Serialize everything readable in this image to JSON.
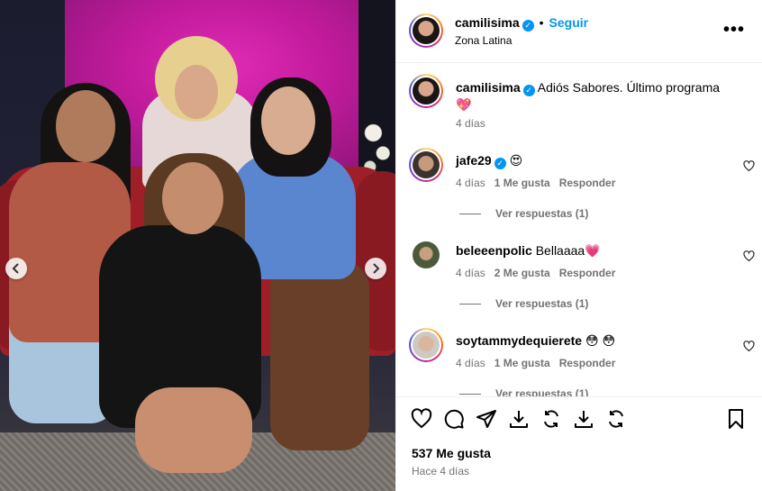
{
  "post": {
    "username": "camilisima",
    "verified_mark": "✓",
    "dot": "•",
    "follow_label": "Seguir",
    "location": "Zona Latina",
    "more_label": "•••"
  },
  "caption": {
    "username": "camilisima",
    "text": "Adiós Sabores. Último programa",
    "emoji": "💖",
    "time": "4 días"
  },
  "comments": [
    {
      "username": "jafe29",
      "verified": true,
      "text": "😍",
      "time": "4 días",
      "likes": "1 Me gusta",
      "reply_label": "Responder",
      "replies_label": "Ver respuestas (1)"
    },
    {
      "username": "beleeenpolic",
      "verified": false,
      "text": "Bellaaaa💗",
      "time": "4 días",
      "likes": "2 Me gusta",
      "reply_label": "Responder",
      "replies_label": "Ver respuestas (1)"
    },
    {
      "username": "soytammydequierete",
      "verified": false,
      "text": "😳 😳",
      "time": "4 días",
      "likes": "1 Me gusta",
      "reply_label": "Responder",
      "replies_label": "Ver respuestas (1)"
    }
  ],
  "footer": {
    "likes_count": "537 Me gusta",
    "posted": "Hace 4 días"
  },
  "icons": {
    "like": "heart-icon",
    "comment": "comment-icon",
    "share": "send-icon",
    "download": "download-icon",
    "repost": "repost-icon",
    "save": "bookmark-icon",
    "prev": "chevron-left-icon",
    "next": "chevron-right-icon"
  },
  "colors": {
    "link_blue": "#0095f6",
    "secondary_text": "#737373",
    "heart_red": "#ff3040",
    "stage_pink": "#c21b9c"
  }
}
